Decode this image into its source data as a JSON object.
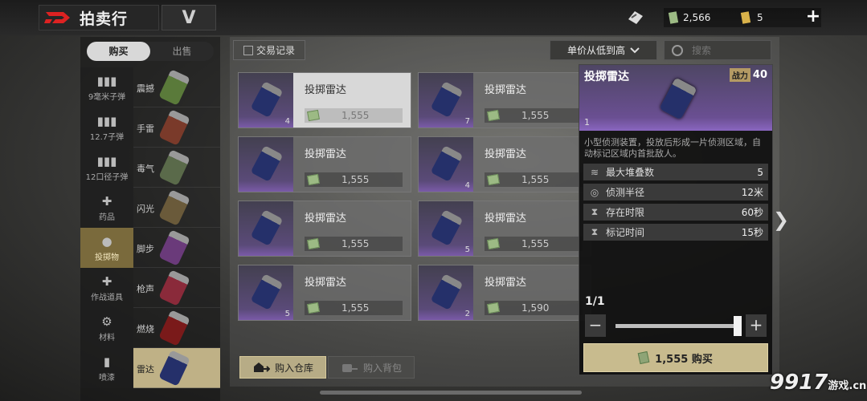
{
  "header": {
    "title": "拍卖行",
    "filter_glyph": "V"
  },
  "resources": [
    {
      "icon": "badge-icon",
      "value": ""
    },
    {
      "icon": "cash-icon",
      "value": "2,566"
    },
    {
      "icon": "ticket-icon",
      "value": "5"
    }
  ],
  "add_label": "+",
  "mode_tabs": {
    "buy": "购买",
    "sell": "出售",
    "active": "buy"
  },
  "categories": [
    {
      "icon": "ammo-icon",
      "label": "9毫米子弹"
    },
    {
      "icon": "ammo-icon",
      "label": "12.7子弹"
    },
    {
      "icon": "ammo-icon",
      "label": "12口径子弹"
    },
    {
      "icon": "medkit-icon",
      "label": "药品"
    },
    {
      "icon": "grenade-icon",
      "label": "投掷物",
      "active": true
    },
    {
      "icon": "shield-plus-icon",
      "label": "作战道具"
    },
    {
      "icon": "gear-icon",
      "label": "材料"
    },
    {
      "icon": "spray-icon",
      "label": "喷漆"
    }
  ],
  "subcategories": [
    "震撼",
    "手雷",
    "毒气",
    "闪光",
    "脚步",
    "枪声",
    "燃烧",
    "雷达"
  ],
  "toolbar": {
    "history_label": "交易记录",
    "sort_label": "单价从低到高",
    "search_placeholder": "搜索"
  },
  "listings": [
    {
      "name": "投掷雷达",
      "qty": "4",
      "price": "1,555",
      "selected": true
    },
    {
      "name": "投掷雷达",
      "qty": "7",
      "price": "1,555"
    },
    {
      "name": "投掷雷达",
      "qty": "",
      "price": "1,555"
    },
    {
      "name": "投掷雷达",
      "qty": "4",
      "price": "1,555"
    },
    {
      "name": "投掷雷达",
      "qty": "",
      "price": "1,555"
    },
    {
      "name": "投掷雷达",
      "qty": "5",
      "price": "1,555"
    },
    {
      "name": "投掷雷达",
      "qty": "5",
      "price": "1,555"
    },
    {
      "name": "投掷雷达",
      "qty": "2",
      "price": "1,590"
    }
  ],
  "bottom_buttons": {
    "warehouse": "购入仓库",
    "backpack": "购入背包"
  },
  "detail": {
    "name": "投掷雷达",
    "power_label": "战力",
    "power": "40",
    "count": "1",
    "description": "小型侦测装置，投放后形成一片侦测区域，自动标记区域内首批敌人。",
    "stats": [
      {
        "icon": "layers-icon",
        "label": "最大堆叠数",
        "value": "5"
      },
      {
        "icon": "radius-icon",
        "label": "侦测半径",
        "value": "12米"
      },
      {
        "icon": "hourglass-icon",
        "label": "存在时限",
        "value": "60秒"
      },
      {
        "icon": "hourglass-icon",
        "label": "标记时间",
        "value": "15秒"
      }
    ],
    "quantity": "1/1",
    "slider_level": 1.0,
    "minus": "−",
    "plus": "+",
    "buy_label": "1,555 购买"
  },
  "watermark": {
    "main": "9917",
    "sub": "游戏",
    "domain": ".cn"
  },
  "colors": {
    "accent_gold": "#c8bb8e",
    "rarity_purple": "#7a5aa8",
    "logo_red": "#d22"
  }
}
